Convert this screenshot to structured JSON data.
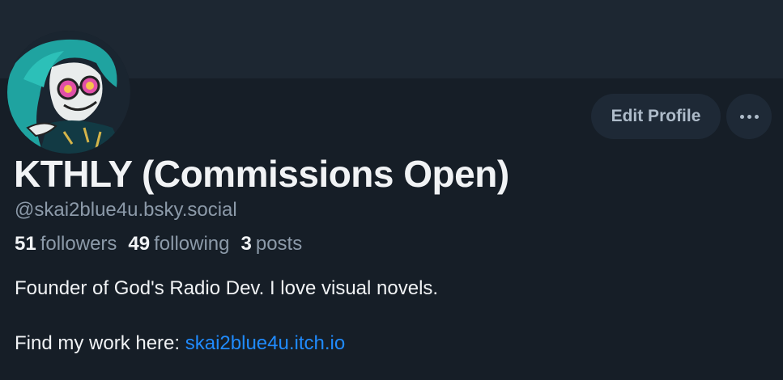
{
  "profile": {
    "display_name": "KTHLY (Commissions Open)",
    "handle": "@skai2blue4u.bsky.social",
    "avatar_icon": "avatar-illustration",
    "stats": {
      "followers_count": "51",
      "followers_label": "followers",
      "following_count": "49",
      "following_label": "following",
      "posts_count": "3",
      "posts_label": "posts"
    },
    "bio": {
      "line1": "Founder of God's Radio Dev. I love visual novels.",
      "line2_prefix": "Find my work here:",
      "link_text": "skai2blue4u.itch.io"
    }
  },
  "actions": {
    "edit_profile_label": "Edit Profile",
    "more_icon": "ellipsis-icon"
  },
  "colors": {
    "background": "#161e27",
    "banner": "#1d2732",
    "button_bg": "#1e2936",
    "text_primary": "#f1f3f5",
    "text_secondary": "#8c9aa9",
    "link": "#208bfe"
  }
}
